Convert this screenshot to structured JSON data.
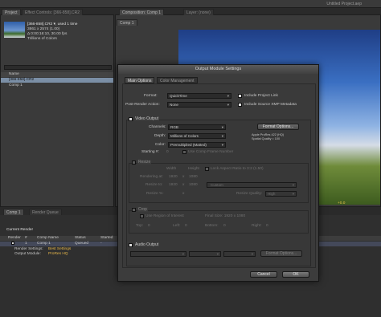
{
  "window": {
    "title": "Untitled Project.aep"
  },
  "project_panel": {
    "tab_project": "Project",
    "tab_effect_controls": "Effect Controls: [366-858].CR2",
    "file_name": "[366-858].CR2 ▾, used 1 time",
    "file_dims": "3861 x 2574 (1.00)",
    "file_duration": "Δ 0:00:16:10, 30.00 fps",
    "file_colors": "Trillions of Colors",
    "col_name": "Name",
    "items": [
      "[366-858].CR2",
      "Comp 1"
    ]
  },
  "composition_panel": {
    "tab": "Composition: Comp 1",
    "layer_tab": "Layer: (none)",
    "comp_tab": "Comp 1",
    "zoom": "+0.0"
  },
  "timeline": {
    "tab_comp": "Comp 1",
    "tab_render_queue": "Render Queue",
    "current_render": "Current Render",
    "headers": [
      "Render",
      "#",
      "Comp Name",
      "Status",
      "Started"
    ],
    "row": {
      "num": "1",
      "comp": "Comp 1",
      "status": "Queued",
      "started": "-"
    },
    "render_settings_label": "Render Settings:",
    "render_settings_value": "Best Settings",
    "output_module_label": "Output Module:",
    "output_module_value": "ProRes HQ"
  },
  "dialog": {
    "title": "Output Module Settings",
    "tab_main": "Main Options",
    "tab_color": "Color Management",
    "format_label": "Format:",
    "format_value": "QuickTime",
    "include_project_link": "Include Project Link",
    "post_render_label": "Post-Render Action:",
    "post_render_value": "None",
    "include_xmp": "Include Source XMP Metadata",
    "video_output": "Video Output",
    "channels_label": "Channels:",
    "channels_value": "RGB",
    "format_options_btn": "Format Options...",
    "depth_label": "Depth:",
    "depth_value": "Millions of Colors",
    "codec_info_1": "Apple ProRes 422 (HQ)",
    "codec_info_2": "Spatial Quality = 100",
    "color_label": "Color:",
    "color_value": "Premultiplied (Matted)",
    "starting_label": "Starting #:",
    "starting_value": "0",
    "use_comp_frame": "Use Comp Frame Number",
    "resize": "Resize",
    "width_hdr": "Width",
    "height_hdr": "Height",
    "lock_aspect": "Lock Aspect Ratio to 3:2 (1.50)",
    "rendering_at": "Rendering at:",
    "render_w": "1920",
    "render_h": "1080",
    "resize_to": "Resize to:",
    "resize_w": "1920",
    "resize_h": "1080",
    "custom": "Custom",
    "resize_pct": "Resize %:",
    "resize_quality_label": "Resize Quality:",
    "resize_quality_value": "High",
    "crop": "Crop",
    "use_roi": "Use Region of Interest",
    "final_size": "Final Size: 1920 x 1080",
    "top_label": "Top:",
    "top_value": "0",
    "left_label": "Left:",
    "left_value": "0",
    "bottom_label": "Bottom:",
    "bottom_value": "0",
    "right_label": "Right:",
    "right_value": "0",
    "audio_output": "Audio Output",
    "audio_format_options": "Format Options...",
    "cancel": "Cancel",
    "ok": "OK"
  }
}
